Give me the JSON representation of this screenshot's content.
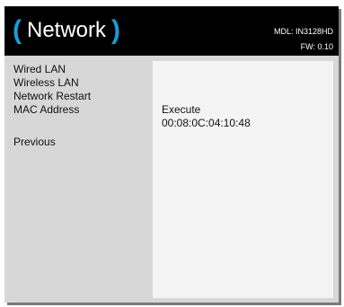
{
  "header": {
    "title_open": "(",
    "title": "Network",
    "title_close": ")",
    "model": "MDL: IN3128HD",
    "firmware": "FW: 0.10"
  },
  "menu": {
    "items": [
      {
        "label": "Wired LAN"
      },
      {
        "label": "Wireless LAN"
      },
      {
        "label": "Network Restart"
      },
      {
        "label": "MAC Address"
      }
    ],
    "previous_label": "Previous"
  },
  "panel": {
    "network_restart_value": "Execute",
    "mac_address_value": "00:08:0C:04:10:48"
  },
  "colors": {
    "header_background": "#000000",
    "accent": "#1a9bd7",
    "menu_background": "#d7d7d7",
    "panel_background": "#f4f4f4"
  }
}
